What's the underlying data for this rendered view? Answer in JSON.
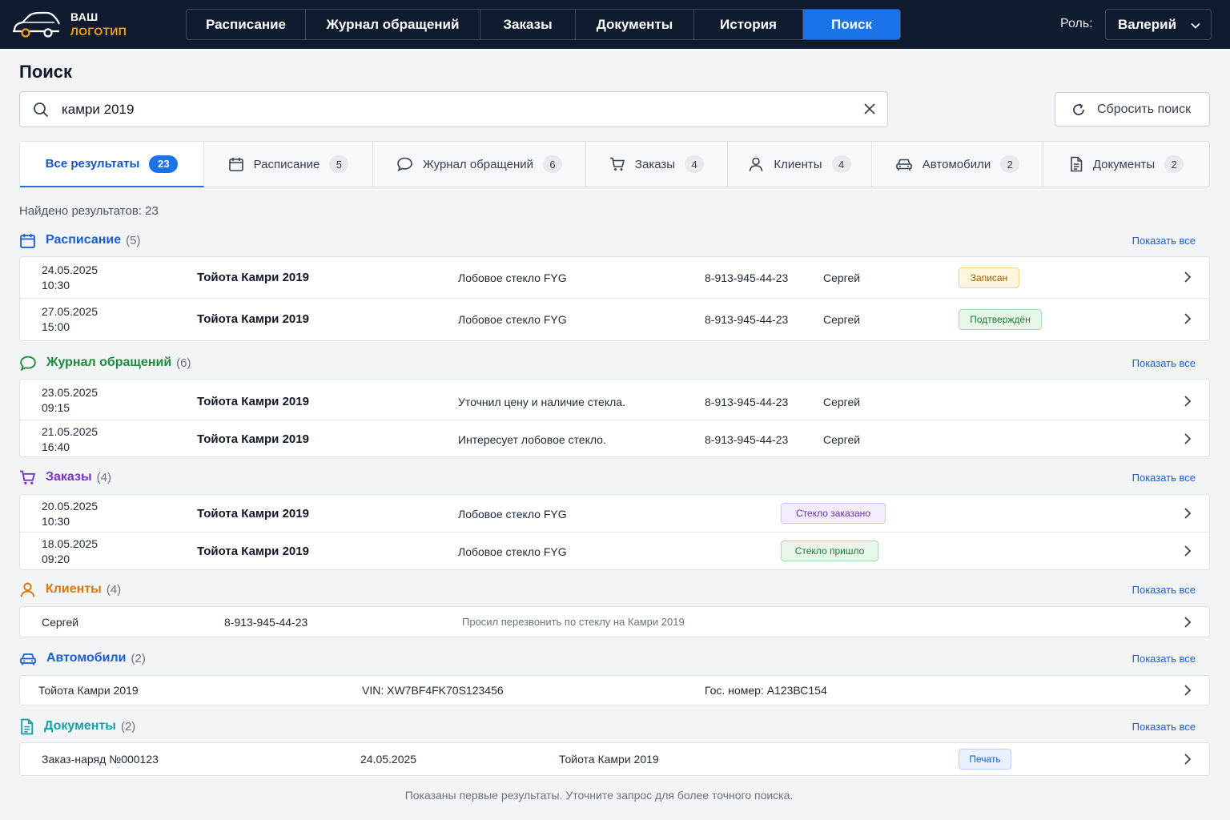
{
  "app": {
    "logo_line1": "ВАШ",
    "logo_line2": "ЛОГОТИП"
  },
  "nav": {
    "tabs": [
      {
        "label": "Расписание"
      },
      {
        "label": "Журнал обращений"
      },
      {
        "label": "Заказы"
      },
      {
        "label": "Документы"
      },
      {
        "label": "История"
      },
      {
        "label": "Поиск",
        "active": true
      }
    ]
  },
  "role": {
    "label": "Роль:",
    "value": "Валерий"
  },
  "page": {
    "title": "Поиск"
  },
  "search": {
    "value": "камри 2019",
    "reset_label": "Сбросить поиск"
  },
  "filters": [
    {
      "label": "Все результаты",
      "count": "23",
      "icon": "none",
      "active": true
    },
    {
      "label": "Расписание",
      "count": "5",
      "icon": "calendar-icon"
    },
    {
      "label": "Журнал обращений",
      "count": "6",
      "icon": "chat-icon"
    },
    {
      "label": "Заказы",
      "count": "4",
      "icon": "cart-icon"
    },
    {
      "label": "Клиенты",
      "count": "4",
      "icon": "user-icon"
    },
    {
      "label": "Автомобили",
      "count": "2",
      "icon": "car-icon"
    },
    {
      "label": "Документы",
      "count": "2",
      "icon": "document-icon"
    }
  ],
  "summary": {
    "found": "Найдено результатов: 23"
  },
  "show_all": "Показать все",
  "sections": {
    "schedule": {
      "title": "Расписание",
      "count": "(5)",
      "color": "#1a5fcc",
      "rows": [
        {
          "date": "24.05.2025",
          "time": "10:30",
          "car": "Тойота Камри 2019",
          "desc": "Лобовое стекло FYG",
          "phone": "8-913-945-44-23",
          "name": "Сергей",
          "badge": "Записан"
        },
        {
          "date": "27.05.2025",
          "time": "15:00",
          "car": "Тойота Камри 2019",
          "desc": "Лобовое стекло FYG",
          "phone": "8-913-945-44-23",
          "name": "Сергей",
          "badge": "Подтверждён"
        }
      ]
    },
    "journal": {
      "title": "Журнал обращений",
      "count": "(6)",
      "color": "#1f8a3d",
      "rows": [
        {
          "date": "23.05.2025",
          "time": "09:15",
          "car": "Тойота Камри 2019",
          "desc": "Уточнил цену и наличие стекла.",
          "phone": "8-913-945-44-23",
          "name": "Сергей"
        },
        {
          "date": "21.05.2025",
          "time": "16:40",
          "car": "Тойота Камри 2019",
          "desc": "Интересует лобовое стекло.",
          "phone": "8-913-945-44-23",
          "name": "Сергей"
        }
      ]
    },
    "orders": {
      "title": "Заказы",
      "count": "(4)",
      "color": "#7a33c9",
      "rows": [
        {
          "date": "20.05.2025",
          "time": "10:30",
          "car": "Тойота Камри 2019",
          "desc": "Лобовое стекло FYG",
          "badge": "Стекло заказано"
        },
        {
          "date": "18.05.2025",
          "time": "09:20",
          "car": "Тойота Камри 2019",
          "desc": "Лобовое стекло FYG",
          "badge": "Стекло пришло"
        }
      ]
    },
    "clients": {
      "title": "Клиенты",
      "count": "(4)",
      "color": "#d97706",
      "rows": [
        {
          "name": "Сергей",
          "phone": "8-913-945-44-23",
          "note": "Просил перезвонить по стеклу на Камри 2019"
        }
      ]
    },
    "cars": {
      "title": "Автомобили",
      "count": "(2)",
      "color": "#1a5fcc",
      "rows": [
        {
          "car": "Тойота Камри 2019",
          "vin": "VIN: XW7BF4FK70S123456",
          "plate": "Гос. номер: А123ВС154"
        }
      ]
    },
    "docs": {
      "title": "Документы",
      "count": "(2)",
      "color": "#16a0a8",
      "rows": [
        {
          "doc": "Заказ-наряд №000123",
          "date": "24.05.2025",
          "car": "Тойота Камри 2019",
          "badge": "Печать"
        }
      ]
    }
  },
  "footer": {
    "note": "Показаны первые результаты. Уточните запрос для более точного поиска."
  }
}
